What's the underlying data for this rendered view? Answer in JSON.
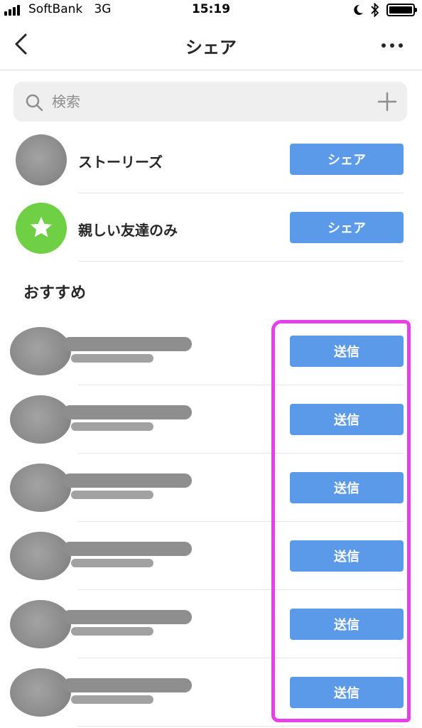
{
  "status_bar": {
    "carrier": "SoftBank",
    "network": "3G",
    "time": "15:19",
    "icons": [
      "signal-icon",
      "moon-icon",
      "bluetooth-icon",
      "battery-icon"
    ]
  },
  "nav": {
    "title": "シェア",
    "back_icon": "chevron-left-icon",
    "more_icon": "more-horizontal-icon"
  },
  "search": {
    "placeholder": "検索",
    "value": "",
    "icon": "search-icon",
    "add_icon": "plus-icon"
  },
  "share_options": [
    {
      "label": "ストーリーズ",
      "button": "シェア",
      "avatar": "blurred-profile-photo"
    },
    {
      "label": "親しい友達のみ",
      "button": "シェア",
      "avatar": "star-icon"
    }
  ],
  "recommended": {
    "title": "おすすめ",
    "items": [
      {
        "button": "送信"
      },
      {
        "button": "送信"
      },
      {
        "button": "送信"
      },
      {
        "button": "送信"
      },
      {
        "button": "送信"
      },
      {
        "button": "送信"
      }
    ]
  },
  "colors": {
    "accent": "#5a9ae8",
    "star_green": "#6fcf45",
    "highlight": "#e840e8",
    "divider": "#e6e6e6",
    "search_bg": "#efefef"
  }
}
